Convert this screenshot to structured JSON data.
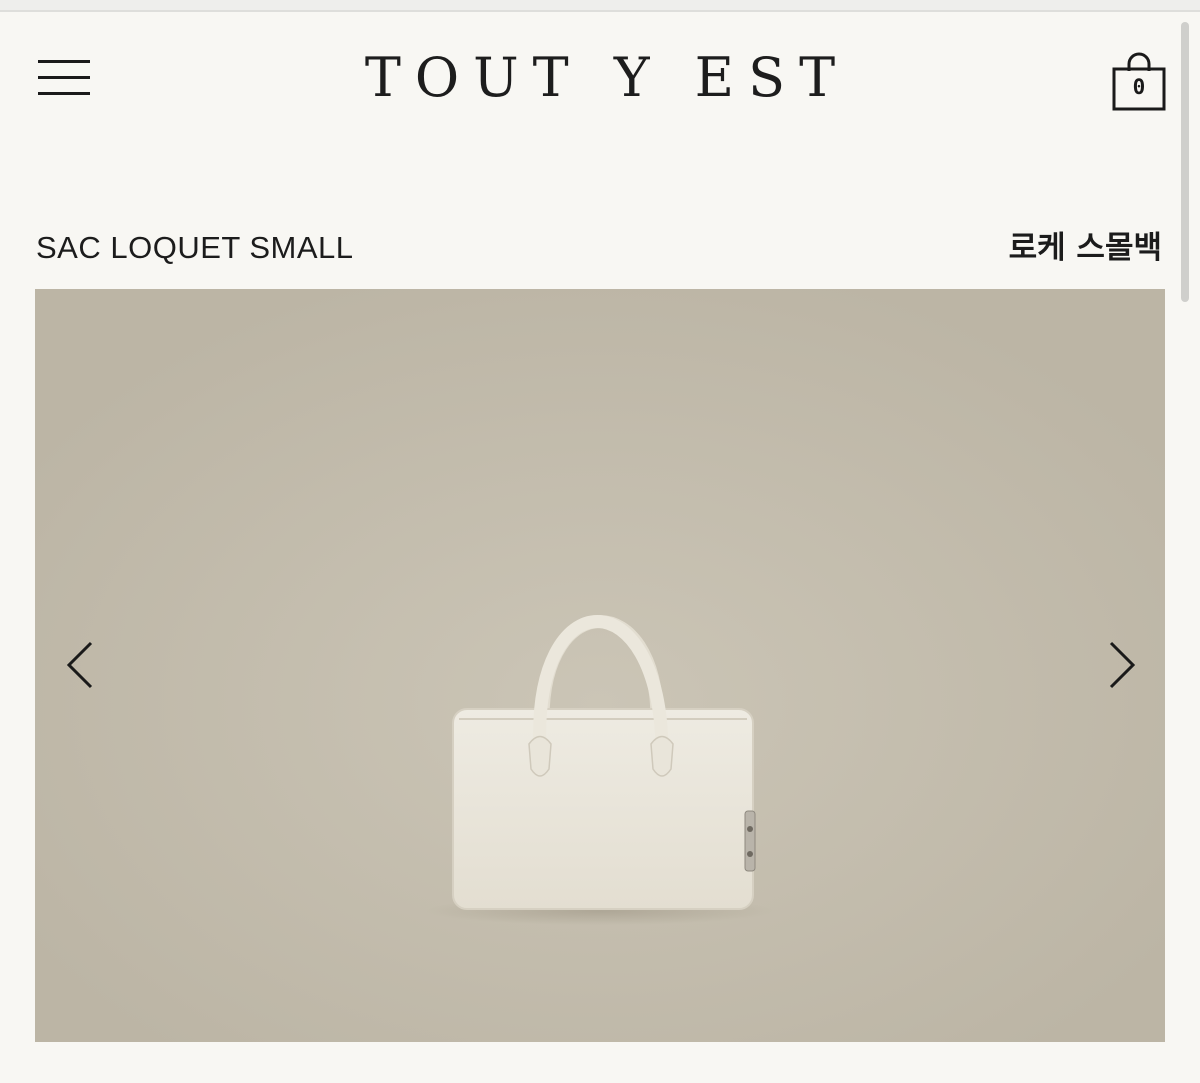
{
  "header": {
    "brand": "TOUT Y EST",
    "menu_icon": "hamburger-menu-icon",
    "cart_icon": "shopping-bag-icon",
    "cart_count": "0"
  },
  "product": {
    "name_en": "SAC LOQUET SMALL",
    "name_ko": "로케 스몰백"
  },
  "carousel": {
    "prev_icon": "chevron-left-icon",
    "next_icon": "chevron-right-icon",
    "image_subject": "ivory-leather-top-handle-bag"
  },
  "colors": {
    "page_background": "#f8f7f3",
    "image_background": "#c4beb0",
    "bag": "#e9e5da",
    "text": "#1a1a1a"
  }
}
